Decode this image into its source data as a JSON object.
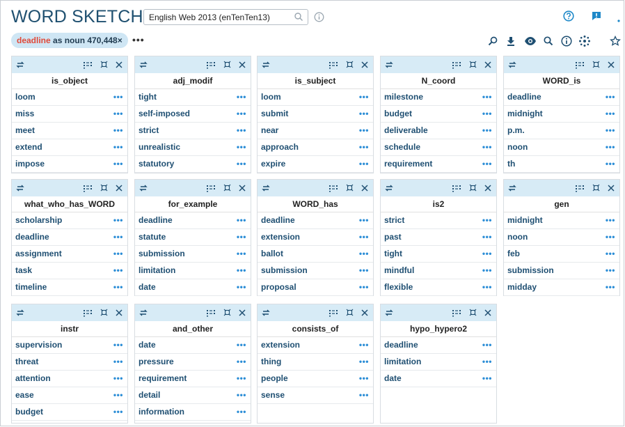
{
  "app": {
    "title": "WORD SKETCH",
    "corpus": "English Web 2013 (enTenTen13)"
  },
  "query": {
    "keyword": "deadline",
    "rest": " as noun 470,448×",
    "menu": "•••"
  },
  "more_label": "•••",
  "colors": {
    "header_bg": "#d7ebf6",
    "link": "#1f4f72",
    "accent": "#2b8dd6",
    "keyword": "#e04a3a"
  },
  "cards": [
    {
      "title": "is_object",
      "items": [
        "loom",
        "miss",
        "meet",
        "extend",
        "impose"
      ]
    },
    {
      "title": "adj_modif",
      "items": [
        "tight",
        "self-imposed",
        "strict",
        "unrealistic",
        "statutory"
      ]
    },
    {
      "title": "is_subject",
      "items": [
        "loom",
        "submit",
        "near",
        "approach",
        "expire"
      ]
    },
    {
      "title": "N_coord",
      "items": [
        "milestone",
        "budget",
        "deliverable",
        "schedule",
        "requirement"
      ]
    },
    {
      "title": "WORD_is",
      "items": [
        "deadline",
        "midnight",
        "p.m.",
        "noon",
        "th"
      ]
    },
    {
      "title": "what_who_has_WORD",
      "items": [
        "scholarship",
        "deadline",
        "assignment",
        "task",
        "timeline"
      ]
    },
    {
      "title": "for_example",
      "items": [
        "deadline",
        "statute",
        "submission",
        "limitation",
        "date"
      ]
    },
    {
      "title": "WORD_has",
      "items": [
        "deadline",
        "extension",
        "ballot",
        "submission",
        "proposal"
      ]
    },
    {
      "title": "is2",
      "items": [
        "strict",
        "past",
        "tight",
        "mindful",
        "flexible"
      ]
    },
    {
      "title": "gen",
      "items": [
        "midnight",
        "noon",
        "feb",
        "submission",
        "midday"
      ]
    },
    {
      "title": "instr",
      "items": [
        "supervision",
        "threat",
        "attention",
        "ease",
        "budget"
      ]
    },
    {
      "title": "and_other",
      "items": [
        "date",
        "pressure",
        "requirement",
        "detail",
        "information"
      ]
    },
    {
      "title": "consists_of",
      "items": [
        "extension",
        "thing",
        "people",
        "sense"
      ]
    },
    {
      "title": "hypo_hypero2",
      "items": [
        "deadline",
        "limitation",
        "date"
      ]
    }
  ]
}
